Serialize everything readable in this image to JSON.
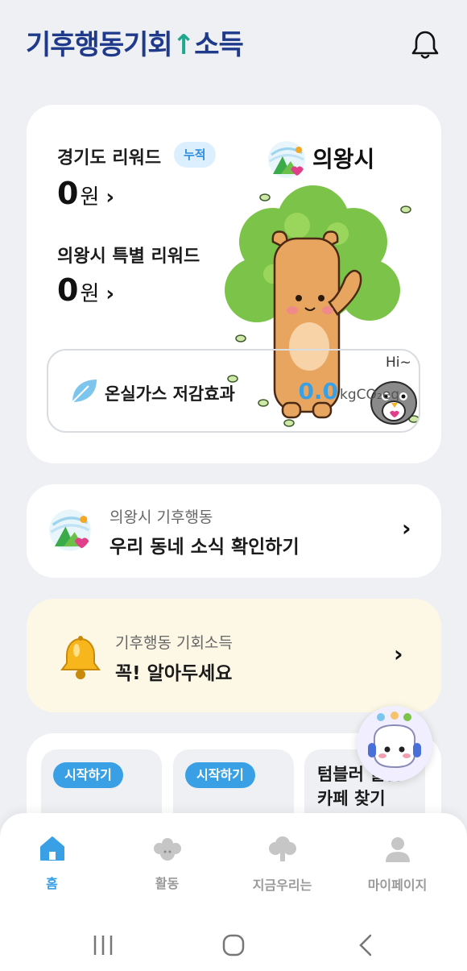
{
  "header": {
    "logo_part1": "기후행동",
    "logo_part2": "기회",
    "logo_part3": "소득",
    "bell_icon": "bell-icon"
  },
  "reward_card": {
    "gyeonggi_label": "경기도 리워드",
    "badge": "누적",
    "gyeonggi_amount": "0",
    "unit": "원",
    "special_label": "의왕시 특별 리워드",
    "special_amount": "0",
    "city_name": "의왕시",
    "greeting": "Hi~",
    "ghg_label": "온실가스 저감효과",
    "ghg_value": "0.0",
    "ghg_unit": "kgCO₂eq"
  },
  "news_card": {
    "subtitle": "의왕시 기후행동",
    "title": "우리 동네 소식 확인하기"
  },
  "notice_card": {
    "subtitle": "기후행동 기회소득",
    "title": "꼭! 알아두세요"
  },
  "missions": [
    {
      "button": "시작하기"
    },
    {
      "button": "시작하기"
    },
    {
      "line1": "텀블러 할인",
      "line2": "카페 찾기"
    }
  ],
  "nav": {
    "items": [
      {
        "label": "홈",
        "icon": "home-icon",
        "active": true
      },
      {
        "label": "활동",
        "icon": "activity-icon",
        "active": false
      },
      {
        "label": "지금우리는",
        "icon": "tree-icon",
        "active": false
      },
      {
        "label": "마이페이지",
        "icon": "person-icon",
        "active": false
      }
    ]
  },
  "colors": {
    "accent": "#3aa0e6",
    "logo_navy": "#1f3a8a",
    "logo_green": "#1ea88f",
    "notice_bg": "#fdf8e6",
    "page_bg": "#eef0f3"
  }
}
